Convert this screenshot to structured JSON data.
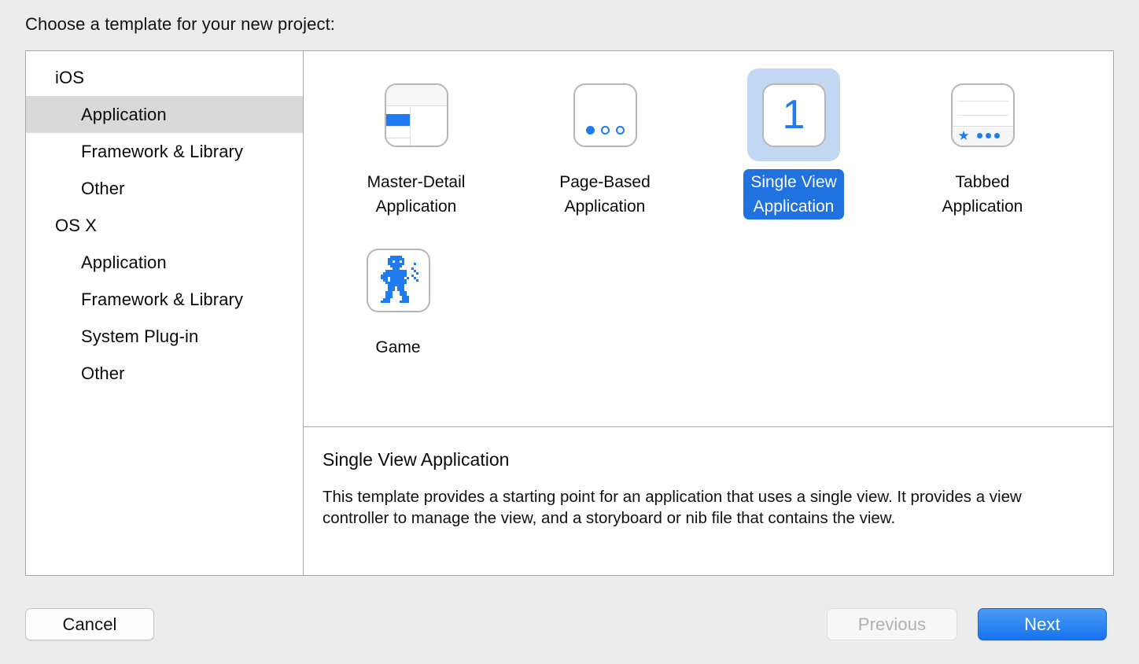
{
  "dialog": {
    "prompt": "Choose a template for your new project:"
  },
  "sidebar": {
    "items": [
      {
        "label": "iOS",
        "level": "group",
        "selected": false
      },
      {
        "label": "Application",
        "level": "child",
        "selected": true
      },
      {
        "label": "Framework & Library",
        "level": "child",
        "selected": false
      },
      {
        "label": "Other",
        "level": "child",
        "selected": false
      },
      {
        "label": "OS X",
        "level": "group",
        "selected": false
      },
      {
        "label": "Application",
        "level": "child",
        "selected": false
      },
      {
        "label": "Framework & Library",
        "level": "child",
        "selected": false
      },
      {
        "label": "System Plug-in",
        "level": "child",
        "selected": false
      },
      {
        "label": "Other",
        "level": "child",
        "selected": false
      }
    ]
  },
  "gallery": {
    "templates": [
      {
        "label": "Master-Detail\nApplication",
        "icon": "master-detail-icon",
        "selected": false
      },
      {
        "label": "Page-Based\nApplication",
        "icon": "page-based-icon",
        "selected": false
      },
      {
        "label": "Single View\nApplication",
        "icon": "single-view-icon",
        "selected": true
      },
      {
        "label": "Tabbed\nApplication",
        "icon": "tabbed-icon",
        "selected": false
      },
      {
        "label": "Game",
        "icon": "game-robot-icon",
        "selected": false
      }
    ],
    "single_view_number": "1",
    "tabbed_star_glyph": "★"
  },
  "description": {
    "title": "Single View Application",
    "body": "This template provides a starting point for an application that uses a single view. It provides a view controller to manage the view, and a storyboard or nib file that contains the view."
  },
  "footer": {
    "cancel_label": "Cancel",
    "previous_label": "Previous",
    "next_label": "Next"
  },
  "colors": {
    "accent_blue": "#1f7bf2",
    "selection_blue": "#1f72e0",
    "selection_blue_light": "#c2d8f2",
    "sidebar_selection_gray": "#d9d9d9",
    "window_background": "#ececec"
  }
}
